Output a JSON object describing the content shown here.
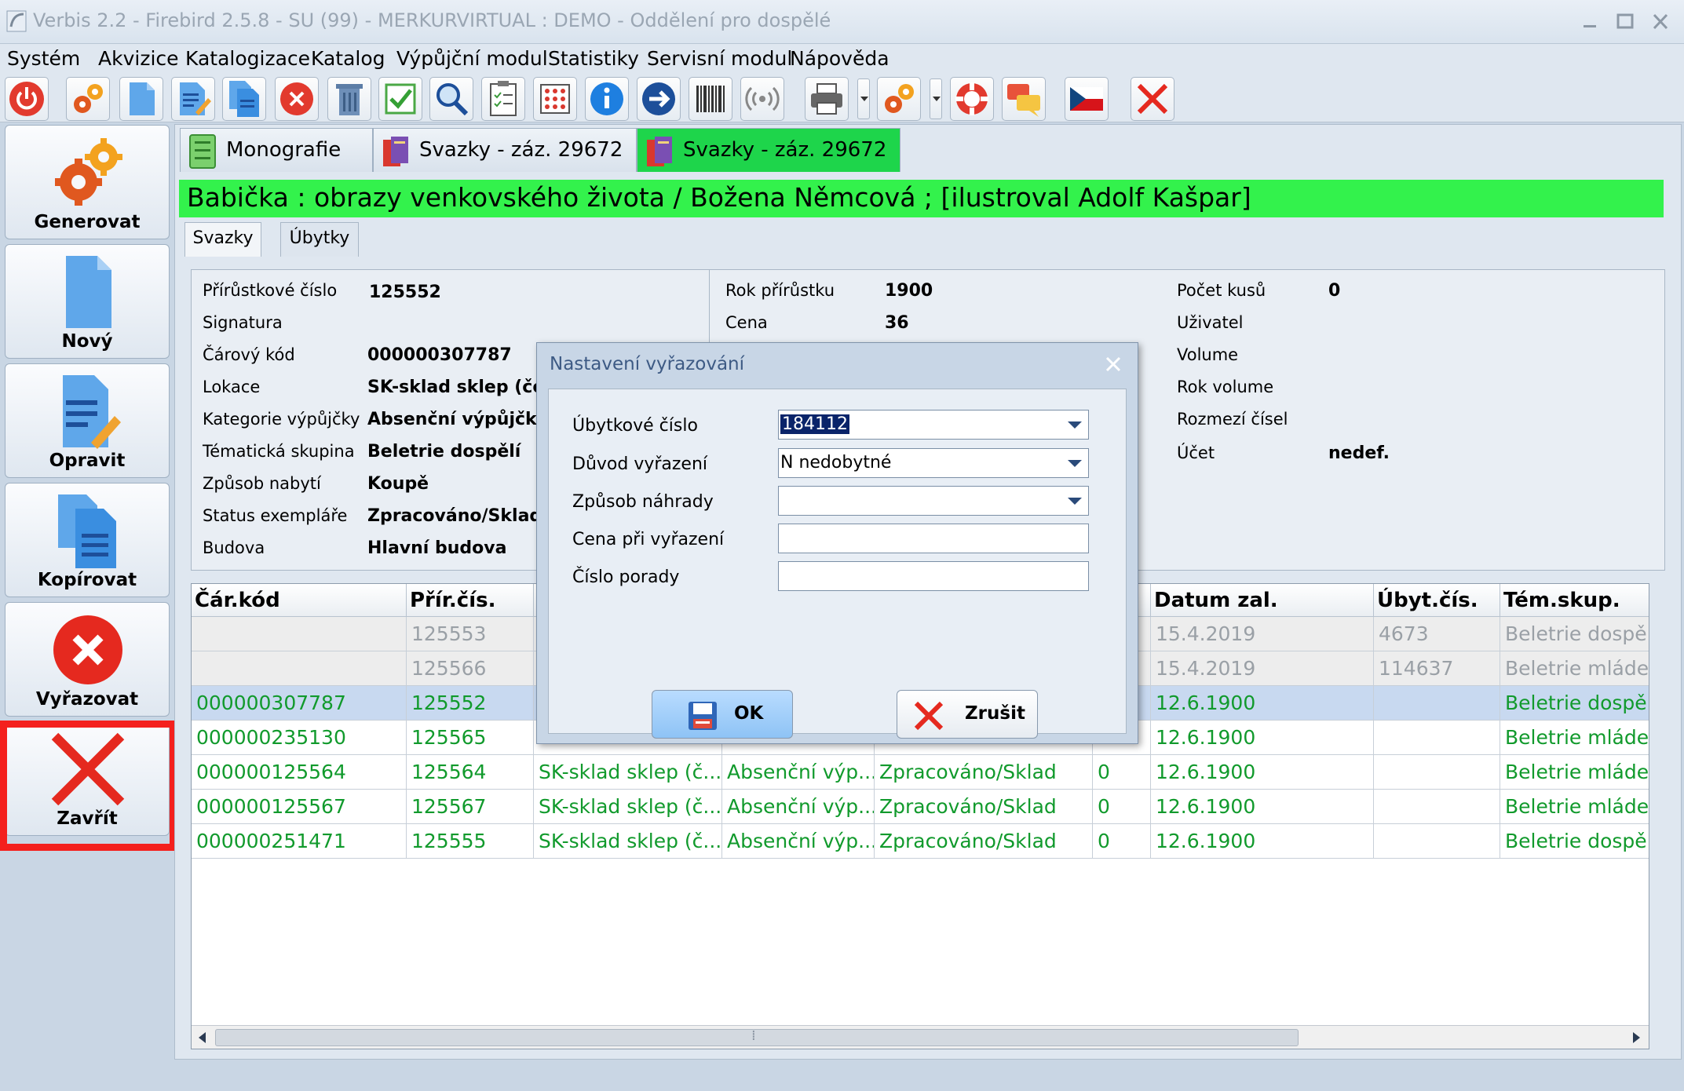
{
  "window": {
    "title": "Verbis 2.2 - Firebird 2.5.8 - SU (99) - MERKURVIRTUAL : DEMO - Oddělení pro dospělé"
  },
  "menu": [
    "Systém",
    "Akvizice",
    "Katalogizace",
    "Katalog",
    "Výpůjční modul",
    "Statistiky",
    "Servisní modul",
    "Nápověda"
  ],
  "toolbar": {
    "icons": [
      "power-icon",
      "gears-icon",
      "new-document-icon",
      "edit-document-icon",
      "copy-document-icon",
      "delete-circle-icon",
      "trash-icon",
      "checkbox-icon",
      "search-icon",
      "clipboard-icon",
      "abacus-icon",
      "info-icon",
      "forward-arrow-icon",
      "barcode-icon",
      "rfid-icon",
      "printer-icon",
      "settings-gears-icon",
      "lifebuoy-icon",
      "chat-icon",
      "czech-flag-icon",
      "close-red-icon"
    ]
  },
  "sidebar": {
    "buttons": [
      {
        "label": "Generovat",
        "icon": "gears-icon"
      },
      {
        "label": "Nový",
        "icon": "new-document-icon"
      },
      {
        "label": "Opravit",
        "icon": "edit-document-icon"
      },
      {
        "label": "Kopírovat",
        "icon": "copy-document-icon"
      },
      {
        "label": "Vyřazovat",
        "icon": "discard-icon"
      },
      {
        "label": "Zavřít",
        "icon": "close-x-icon"
      }
    ]
  },
  "form_tabs": [
    {
      "label": "Monografie"
    },
    {
      "label": "Svazky - záz. 29672"
    },
    {
      "label": "Svazky - záz. 29672"
    }
  ],
  "record_title": "Babička : obrazy venkovského života / Božena Němcová ; [ilustroval Adolf Kašpar]",
  "sub_tabs": [
    "Svazky",
    "Úbytky"
  ],
  "details_left": [
    {
      "label": "Přírůstkové číslo",
      "value": "125552"
    },
    {
      "label": "Signatura",
      "value": ""
    },
    {
      "label": "Čárový kód",
      "value": "000000307787"
    },
    {
      "label": "Lokace",
      "value": "SK-sklad sklep (čer"
    },
    {
      "label": "Kategorie výpůjčky",
      "value": "Absenční výpůjčka"
    },
    {
      "label": "Tématická skupina",
      "value": "Beletrie dospělí"
    },
    {
      "label": "Způsob nabytí",
      "value": "Koupě"
    },
    {
      "label": "Status exempláře",
      "value": "Zpracováno/Sklad"
    },
    {
      "label": "Budova",
      "value": "Hlavní budova"
    }
  ],
  "details_mid": [
    {
      "label": "Rok přírůstku",
      "value": "1900"
    },
    {
      "label": "Cena",
      "value": "36"
    }
  ],
  "details_right": [
    {
      "label": "Počet kusů",
      "value": "0"
    },
    {
      "label": "Uživatel",
      "value": ""
    },
    {
      "label": "Volume",
      "value": ""
    },
    {
      "label": "Rok volume",
      "value": ""
    },
    {
      "label": "Rozmezí čísel",
      "value": ""
    },
    {
      "label": "Účet",
      "value": "nedef."
    }
  ],
  "grid": {
    "headers": [
      "Čár.kód",
      "Přír.čís.",
      "",
      "",
      "",
      "",
      "Datum zal.",
      "Úbyt.čís.",
      "Tém.skup."
    ],
    "rows": [
      {
        "style": "grey",
        "cells": [
          "",
          "125553",
          "",
          "",
          "",
          "",
          "15.4.2019",
          "4673",
          "Beletrie dospělí"
        ]
      },
      {
        "style": "grey",
        "cells": [
          "",
          "125566",
          "",
          "",
          "",
          "",
          "15.4.2019",
          "114637",
          "Beletrie mládež"
        ]
      },
      {
        "style": "green sel",
        "cells": [
          "000000307787",
          "125552",
          "",
          "",
          "",
          "",
          "12.6.1900",
          "",
          "Beletrie dospělí"
        ]
      },
      {
        "style": "green",
        "cells": [
          "000000235130",
          "125565",
          "",
          "",
          "",
          "",
          "12.6.1900",
          "",
          "Beletrie mládež"
        ]
      },
      {
        "style": "green",
        "cells": [
          "000000125564",
          "125564",
          "SK-sklad sklep (č...",
          "Absenční výp...",
          "Zpracováno/Sklad",
          "0",
          "12.6.1900",
          "",
          "Beletrie mládež"
        ]
      },
      {
        "style": "green",
        "cells": [
          "000000125567",
          "125567",
          "SK-sklad sklep (č...",
          "Absenční výp...",
          "Zpracováno/Sklad",
          "0",
          "12.6.1900",
          "",
          "Beletrie mládež"
        ]
      },
      {
        "style": "green",
        "cells": [
          "000000251471",
          "125555",
          "SK-sklad sklep (č...",
          "Absenční výp...",
          "Zpracováno/Sklad",
          "0",
          "12.6.1900",
          "",
          "Beletrie dospělí"
        ]
      }
    ],
    "scroll_thumb_glyph": "⁞"
  },
  "dialog": {
    "title": "Nastavení vyřazování",
    "fields": [
      {
        "label": "Úbytkové číslo",
        "value": "184112",
        "dropdown": true
      },
      {
        "label": "Důvod vyřazení",
        "value": "N nedobytné",
        "dropdown": true
      },
      {
        "label": "Způsob náhrady",
        "value": "",
        "dropdown": true
      },
      {
        "label": "Cena při vyřazení",
        "value": "",
        "dropdown": false
      },
      {
        "label": "Číslo porady",
        "value": "",
        "dropdown": false
      }
    ],
    "ok_label": "OK",
    "cancel_label": "Zrušit"
  },
  "colors": {
    "record_header_bg": "#33f24c",
    "active_tab_bg": "#1ed54b",
    "highlight_border": "#f4201d",
    "green_text": "#119a2c"
  }
}
